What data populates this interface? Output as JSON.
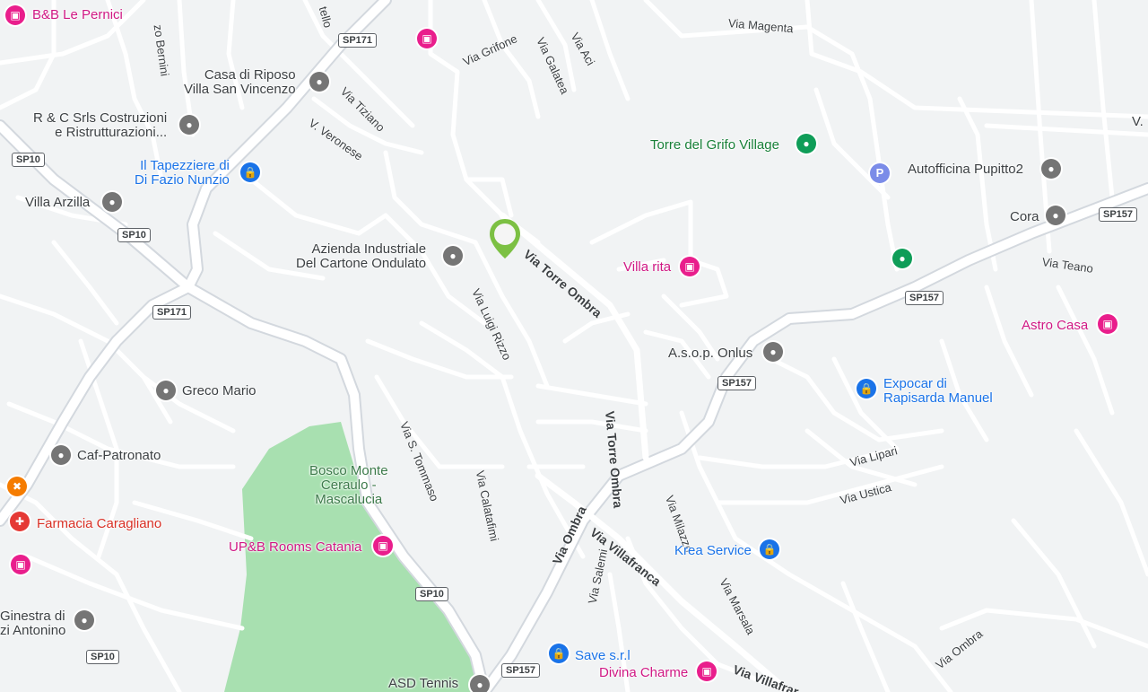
{
  "map": {
    "colors": {
      "background": "#f1f3f4",
      "road_minor": "#ffffff",
      "road_main": "#ffffff",
      "road_casing": "#c8cdd3",
      "park": "#a8e0b0",
      "marker_green": "#7cc043"
    },
    "places": {
      "bb_le_pernici": "B&B Le Pernici",
      "casa_riposo_1": "Casa di Riposo",
      "casa_riposo_2": "Villa San Vincenzo",
      "rc_srls_1": "R & C Srls Costruzioni",
      "rc_srls_2": "e Ristrutturazioni...",
      "tapezziere_1": "Il Tapezziere di",
      "tapezziere_2": "Di Fazio Nunzio",
      "villa_arzilla": "Villa Arzilla",
      "azienda_1": "Azienda Industriale",
      "azienda_2": "Del Cartone Ondulato",
      "torre_grifo": "Torre del Grifo Village",
      "autofficina": "Autofficina Pupitto2",
      "cora": "Cora",
      "villa_rita": "Villa rita",
      "astro_casa": "Astro Casa",
      "asop": "A.s.o.p. Onlus",
      "expocar_1": "Expocar di",
      "expocar_2": "Rapisarda Manuel",
      "greco_mario": "Greco Mario",
      "caf": "Caf-Patronato",
      "bosco_1": "Bosco Monte",
      "bosco_2": "Ceraulo -",
      "bosco_3": "Mascalucia",
      "farmacia": "Farmacia Caragliano",
      "upb_rooms": "UP&B Rooms Catania",
      "krea": "Krea Service",
      "ginestra_1": "Ginestra di",
      "ginestra_2": "zi Antonino",
      "save_srl": "Save s.r.l",
      "divina": "Divina Charme",
      "asd_tennis": "ASD Tennis",
      "edge_v": "V."
    },
    "streets": {
      "zo_bernini": "zo Bernini",
      "tello": "tello",
      "via_grifone": "Via Grifone",
      "via_galatea": "Via Galatea",
      "via_aci": "Via Aci",
      "via_magenta": "Via Magenta",
      "via_tiziano": "Via Tiziano",
      "v_veronese": "V. Veronese",
      "via_torre_ombra_1": "Via Torre Ombra",
      "via_torre_ombra_2": "Via Torre Ombra",
      "via_luigi_rizzo": "Via Luigi Rizzo",
      "via_teano": "Via Teano",
      "via_s_tommaso": "Via S. Tommaso",
      "via_calatafimi": "Via Calatafimi",
      "via_milazzo": "Via Milazzo",
      "via_lipari": "Via Lipari",
      "via_ustica": "Via Ustica",
      "via_ombra_1": "Via Ombra",
      "via_ombra_2": "Via Ombra",
      "via_villafranca_1": "Via Villafranca",
      "via_villafranca_2": "Via Villafrar",
      "via_salemi": "Via Salemi",
      "via_marsala": "Via Marsala"
    },
    "shields": {
      "sp171_a": "SP171",
      "sp171_b": "SP171",
      "sp10_a": "SP10",
      "sp10_b": "SP10",
      "sp10_c": "SP10",
      "sp10_d": "SP10",
      "sp157_a": "SP157",
      "sp157_b": "SP157",
      "sp157_c": "SP157",
      "sp157_d": "SP157"
    },
    "icons": {
      "hotel": "bed-icon",
      "generic": "place-icon",
      "shopping": "shopping-bag-icon",
      "park": "tree-icon",
      "parking": "parking-icon",
      "restaurant": "fork-knife-icon",
      "pharmacy": "pharmacy-icon",
      "location": "location-pin-icon"
    },
    "parking_glyph": "P"
  }
}
